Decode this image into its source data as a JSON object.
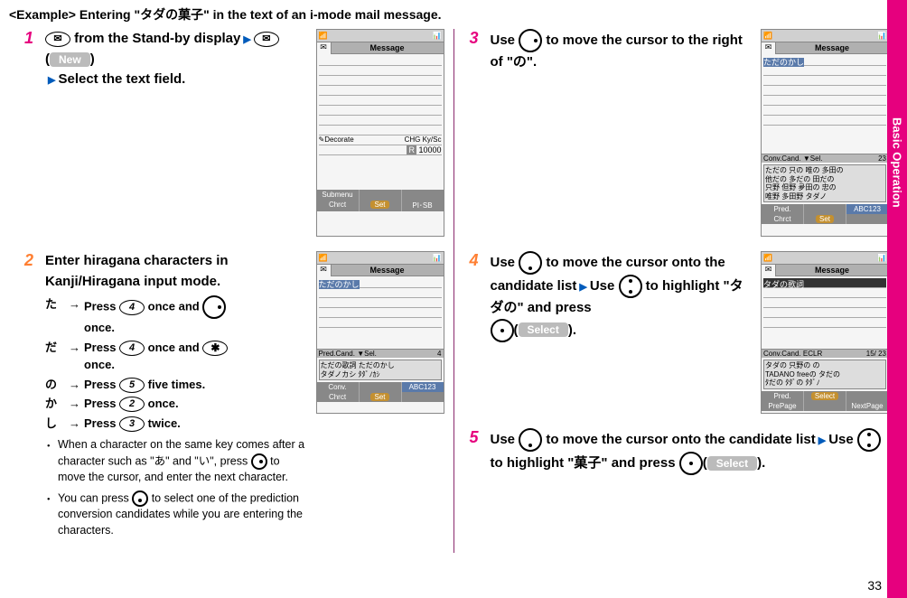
{
  "header": "<Example> Entering \"タダの菓子\" in the text of an i-mode mail message.",
  "sidebar": "Basic Operation",
  "page_num": "33",
  "btn_new": "New",
  "btn_select": "Select",
  "steps": {
    "s1": {
      "part1": " from the Stand-by display",
      "part2": "(",
      "part3": ")",
      "part4": "Select the text field."
    },
    "s2": {
      "main": "Enter hiragana characters in Kanji/Hiragana input mode.",
      "rows": [
        {
          "h": "た",
          "t": "Press ",
          "k": "4",
          "a": " once and ",
          "after": "once."
        },
        {
          "h": "だ",
          "t": "Press ",
          "k": "4",
          "a": " once and ",
          "after": "once."
        },
        {
          "h": "の",
          "t": "Press ",
          "k": "5",
          "a": " five times.",
          "after": ""
        },
        {
          "h": "か",
          "t": "Press ",
          "k": "2",
          "a": " once.",
          "after": ""
        },
        {
          "h": "し",
          "t": "Press ",
          "k": "3",
          "a": " twice.",
          "after": ""
        }
      ],
      "b1": "When a character on the same key comes after a character such as \"あ\" and \"い\", press ",
      "b1b": " to move the cursor, and enter the next character.",
      "b2": "You can press ",
      "b2b": " to select one of the prediction conversion candidates while you are entering the characters."
    },
    "s3": {
      "p1": "Use ",
      "p2": " to move the cursor to the right of \"の\"."
    },
    "s4": {
      "p1": "Use ",
      "p2": " to move the cursor onto the candidate list",
      "p3": "Use ",
      "p4": " to highlight \"タダの\" and press ",
      "p5": "(",
      "p6": ")."
    },
    "s5": {
      "p1": "Use ",
      "p2": " to move the cursor onto the candidate list",
      "p3": "Use ",
      "p4": " to highlight \"菓子\" and press ",
      "p5": "(",
      "p6": ")."
    }
  },
  "scr": {
    "msg": "Message",
    "decorate": "Decorate",
    "chg": "CHG Ky/Sc",
    "r10000": "10000",
    "submenu": "Submenu",
    "chrct": "Chrct",
    "set": "Set",
    "plsb": "PI･SB",
    "tadanokashi": "ただのかし",
    "pred_cand": "Pred.Cand.",
    "sel": "Sel.",
    "cand_line1": "ただの歌詞 ただのかし",
    "cand_line2": "タダノカシ ﾀﾀﾞﾉｶｼ",
    "conv": "Conv.",
    "abc": "ABC123",
    "conv_cand": "Conv.Cand.",
    "c3_l1": "ただの 只の 唯の 多田の",
    "c3_l2": "他だの 多だの 田だの",
    "c3_l3": "只野 但野 夛田の 忠の",
    "c3_l4": "唯野 多田野 タダノ",
    "pred": "Pred.",
    "tadano_kashi2": "タダの歌詞",
    "c4_count": "15/ 23",
    "c4_l1": "タダの 只野の の",
    "c4_l2": "TADANO freeの タだの",
    "c4_l3": "ﾀだの ﾀﾀﾞの ﾀﾀﾞﾉ",
    "prepage": "PrePage",
    "nextpage": "NextPage",
    "select_soft": "Select",
    "r": "R",
    "c3_count": "23",
    "eclr": "ECLR"
  }
}
